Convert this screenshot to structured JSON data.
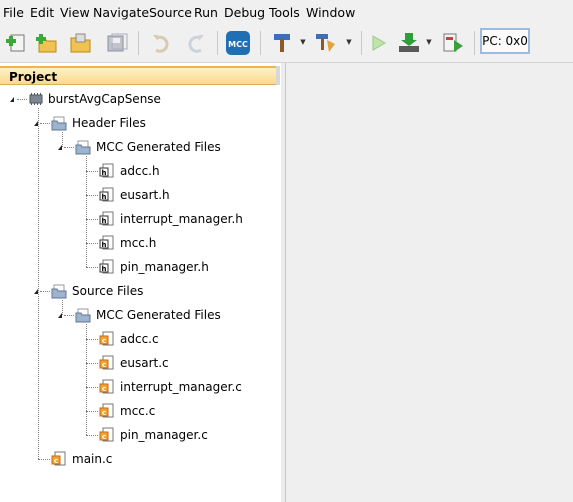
{
  "menubar": {
    "items": [
      "File",
      "Edit",
      "View",
      "Navigate",
      "Source",
      "Run",
      "Debug",
      "Tools",
      "Window"
    ]
  },
  "toolbar": {
    "buttons": [
      {
        "name": "new-file-icon"
      },
      {
        "name": "new-project-icon"
      },
      {
        "name": "open-project-icon"
      },
      {
        "name": "save-all-icon"
      },
      {
        "name": "undo-icon"
      },
      {
        "name": "redo-icon"
      },
      {
        "name": "mcc-icon",
        "label": "MCC"
      },
      {
        "name": "build-hammer-icon"
      },
      {
        "name": "clean-build-icon"
      },
      {
        "name": "run-icon"
      },
      {
        "name": "program-device-icon"
      },
      {
        "name": "debug-project-icon"
      }
    ],
    "pc_label": "PC: 0x0"
  },
  "project_panel": {
    "title": "Project",
    "tree": [
      {
        "label": "burstAvgCapSense",
        "icon": "chip-project-icon"
      },
      {
        "label": "Header Files",
        "icon": "folder-icon"
      },
      {
        "label": "MCC Generated Files",
        "icon": "folder-icon"
      },
      {
        "label": "adcc.h",
        "icon": "header-file-icon"
      },
      {
        "label": "eusart.h",
        "icon": "header-file-icon"
      },
      {
        "label": "interrupt_manager.h",
        "icon": "header-file-icon"
      },
      {
        "label": "mcc.h",
        "icon": "header-file-icon"
      },
      {
        "label": "pin_manager.h",
        "icon": "header-file-icon"
      },
      {
        "label": "Source Files",
        "icon": "folder-icon"
      },
      {
        "label": "MCC Generated Files",
        "icon": "folder-icon"
      },
      {
        "label": "adcc.c",
        "icon": "c-file-icon"
      },
      {
        "label": "eusart.c",
        "icon": "c-file-icon"
      },
      {
        "label": "interrupt_manager.c",
        "icon": "c-file-icon"
      },
      {
        "label": "mcc.c",
        "icon": "c-file-icon"
      },
      {
        "label": "pin_manager.c",
        "icon": "c-file-icon"
      },
      {
        "label": "main.c",
        "icon": "c-file-icon"
      }
    ]
  },
  "colors": {
    "tab_accent": "#f0b649",
    "editor_background": "#efefef",
    "menu_background": "#f0f0f0"
  }
}
